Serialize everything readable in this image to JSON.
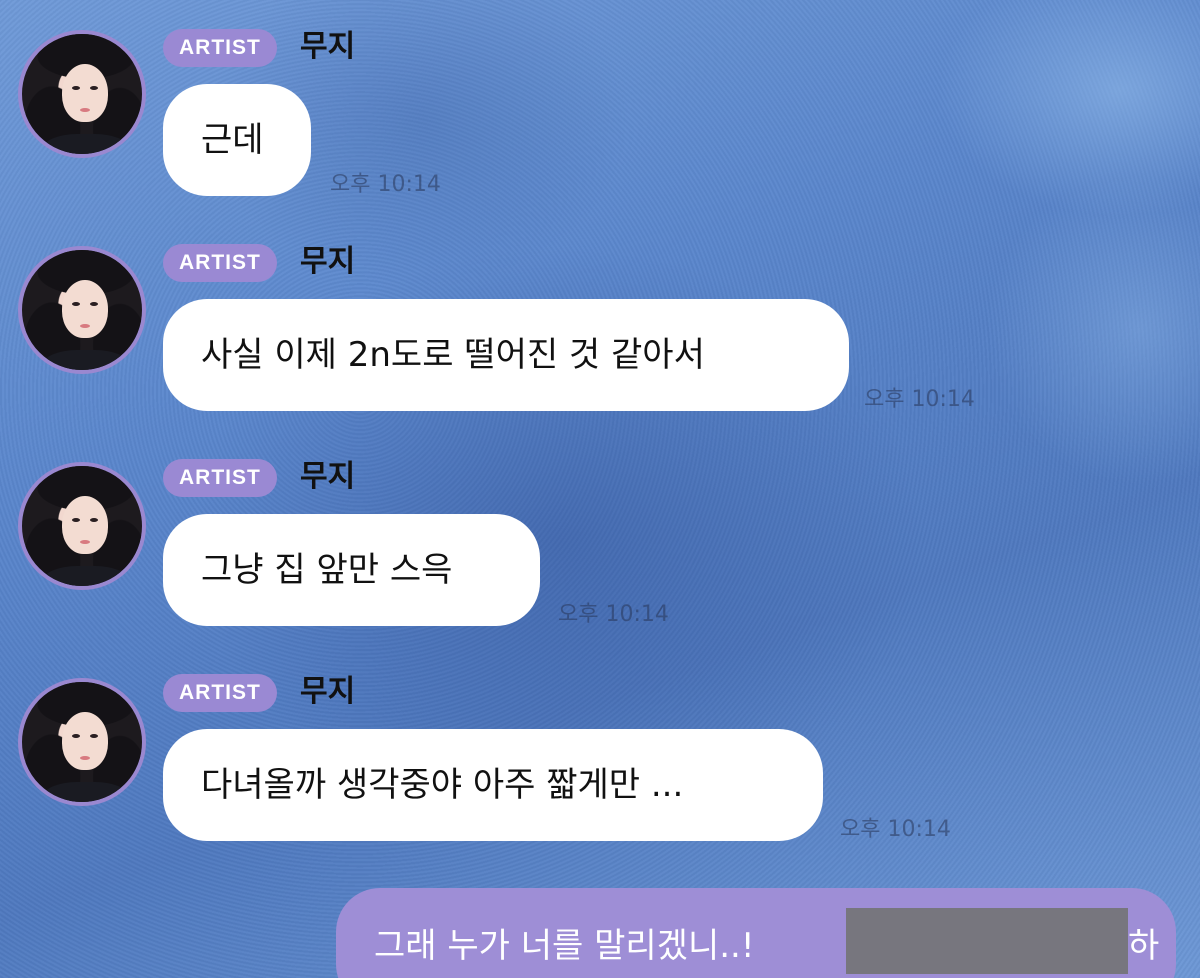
{
  "messages": [
    {
      "badge": "ARTIST",
      "sender": "무지",
      "text": "근데",
      "time": "오후 10:14"
    },
    {
      "badge": "ARTIST",
      "sender": "무지",
      "text": "사실 이제 2n도로 떨어진 것 같아서",
      "time": "오후 10:14"
    },
    {
      "badge": "ARTIST",
      "sender": "무지",
      "text": "그냥 집 앞만 스윽",
      "time": "오후 10:14"
    },
    {
      "badge": "ARTIST",
      "sender": "무지",
      "text": "다녀올까 생각중야 아주 짧게만 ...",
      "time": "오후 10:14"
    }
  ],
  "my_message": {
    "text": "그래 누가 너를 말리겠니..!",
    "tail": "하"
  },
  "colors": {
    "badge": "#9a89d3",
    "my_bubble": "#9e8ed6",
    "avatar_ring": "#9a88d0",
    "background": "#5a86cc"
  }
}
